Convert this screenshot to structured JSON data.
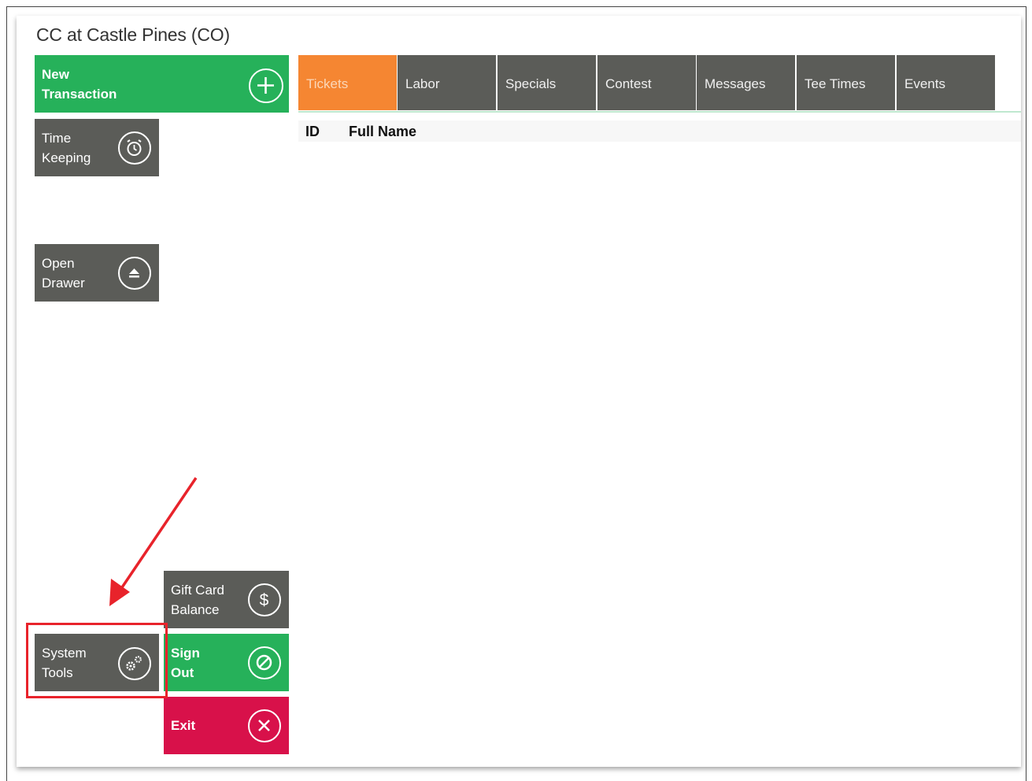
{
  "app": {
    "title": "CC at Castle Pines (CO)"
  },
  "tiles": {
    "new_transaction": {
      "label": "New\nTransaction",
      "icon": "plus-circle-icon",
      "color": "#26b15a"
    },
    "time_keeping": {
      "label": "Time\nKeeping",
      "icon": "alarm-clock-icon",
      "color": "#5b5c58"
    },
    "open_drawer": {
      "label": "Open\nDrawer",
      "icon": "eject-icon",
      "color": "#5b5c58"
    },
    "gift_card_balance": {
      "label": "Gift Card\nBalance",
      "icon": "dollar-icon",
      "color": "#5b5c58"
    },
    "system_tools": {
      "label": "System\nTools",
      "icon": "gears-icon",
      "color": "#5b5c58"
    },
    "sign_out": {
      "label": "Sign\nOut",
      "icon": "no-entry-icon",
      "color": "#26b15a"
    },
    "exit": {
      "label": "Exit",
      "icon": "close-circle-icon",
      "color": "#d8114a"
    }
  },
  "tabs": [
    {
      "label": "Tickets",
      "active": true,
      "color": "#f58632"
    },
    {
      "label": "Labor"
    },
    {
      "label": "Specials"
    },
    {
      "label": "Contest"
    },
    {
      "label": "Messages"
    },
    {
      "label": "Tee Times"
    },
    {
      "label": "Events"
    }
  ],
  "table": {
    "columns": [
      "ID",
      "Full Name"
    ],
    "rows": []
  },
  "annotation": {
    "highlight_color": "#e8232b",
    "target": "System Tools"
  }
}
